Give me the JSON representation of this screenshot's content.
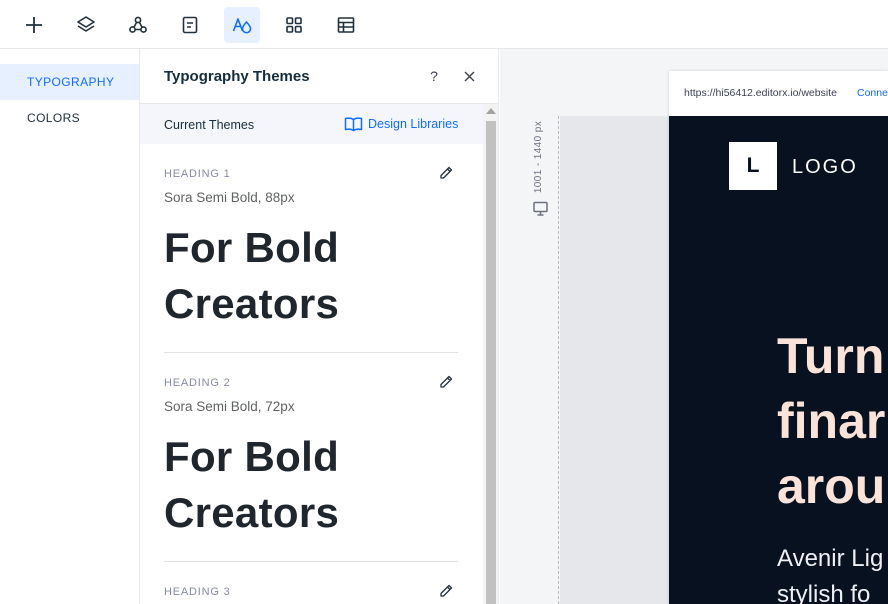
{
  "toolbar": {
    "tools": [
      {
        "name": "add-icon",
        "active": false
      },
      {
        "name": "layers-icon",
        "active": false
      },
      {
        "name": "connect-icon",
        "active": false
      },
      {
        "name": "pages-icon",
        "active": false
      },
      {
        "name": "theme-icon",
        "active": true
      },
      {
        "name": "apps-icon",
        "active": false
      },
      {
        "name": "cms-icon",
        "active": false
      }
    ]
  },
  "categories": {
    "items": [
      {
        "label": "TYPOGRAPHY",
        "active": true
      },
      {
        "label": "COLORS",
        "active": false
      }
    ]
  },
  "panel": {
    "title": "Typography Themes",
    "help": "?",
    "current_themes": "Current Themes",
    "design_libraries": "Design Libraries",
    "themes": [
      {
        "label": "HEADING 1",
        "spec": "Sora Semi Bold, 88px",
        "preview_line1": "For Bold",
        "preview_line2": "Creators"
      },
      {
        "label": "HEADING 2",
        "spec": "Sora Semi Bold, 72px",
        "preview_line1": "For Bold",
        "preview_line2": "Creators"
      },
      {
        "label": "HEADING 3"
      }
    ]
  },
  "canvas": {
    "breakpoint": "1001 - 1440 px",
    "url": "https://hi56412.editorx.io/website",
    "url_link": "Conne",
    "logo_letter": "L",
    "logo_text": "LOGO",
    "hero_lines": [
      "Turn",
      "finar",
      "arou"
    ],
    "sub_lines": [
      "Avenir Lig",
      "stylish fo"
    ]
  },
  "colors": {
    "accent": "#116dff",
    "active_bg": "#e7f0ff",
    "site_bg": "#07111f",
    "hero_text": "#fbe3d9"
  }
}
